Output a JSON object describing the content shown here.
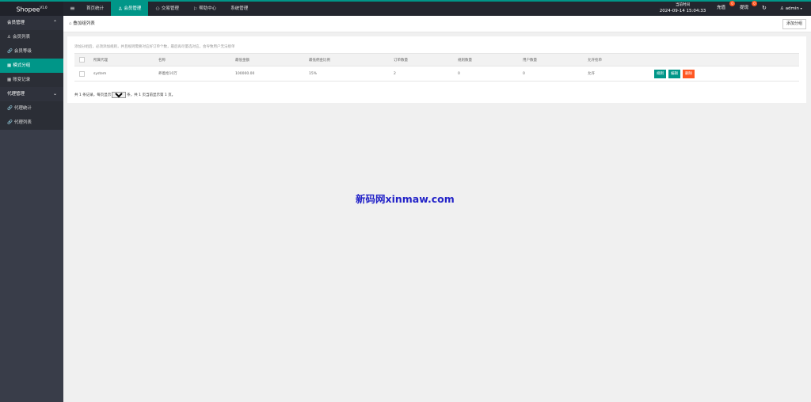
{
  "app": {
    "name": "Shopee",
    "version": "V1.0"
  },
  "topnav": {
    "toggle_icon": "≡",
    "items": [
      {
        "label": "首页统计",
        "icon": ""
      },
      {
        "label": "会员管理",
        "icon": "♙"
      },
      {
        "label": "交易管理",
        "icon": "⚇"
      },
      {
        "label": "帮助中心",
        "icon": "⚐"
      },
      {
        "label": "系统管理",
        "icon": ""
      }
    ],
    "active_index": 1,
    "clock_label": "当前时间",
    "clock_value": "2024-09-14 15:04:33",
    "recharge_label": "充值",
    "recharge_badge": "0",
    "withdraw_label": "提现",
    "withdraw_badge": "0",
    "refresh_icon": "↻",
    "user_label": "admin"
  },
  "sidebar": {
    "groups": [
      {
        "label": "会员管理",
        "items": [
          {
            "label": "会员列表",
            "icon": "user-icon"
          },
          {
            "label": "会员等级",
            "icon": "link-icon"
          },
          {
            "label": "模式分组",
            "icon": "table-icon"
          },
          {
            "label": "账变记录",
            "icon": "table-icon"
          }
        ]
      },
      {
        "label": "代理管理",
        "items": [
          {
            "label": "代理统计",
            "icon": "link-icon"
          },
          {
            "label": "代理列表",
            "icon": "link-icon"
          }
        ]
      }
    ],
    "active": "模式分组"
  },
  "page": {
    "breadcrumb": "叠加组列表",
    "add_button": "添加分组",
    "note": "添加分组后，必须添加规则，并且规则需要对应好订单个数，最后再尽量选对应，会导致用户无法接单"
  },
  "table": {
    "headers": [
      "所属代理",
      "名称",
      "最低金额",
      "最低佣金比例",
      "订单数量",
      "规则数量",
      "用户数量",
      "允许抢单"
    ],
    "rows": [
      {
        "agent": "system",
        "name": "养着抢10万",
        "min_amount": "100000.00",
        "min_commission": "15%",
        "orders": "2",
        "rules": "0",
        "users": "0",
        "allow": "允许"
      }
    ],
    "actions": [
      "规则",
      "编辑",
      "删除"
    ]
  },
  "pager": {
    "prefix": "共 1 条记录，每页显示",
    "page_size": "20",
    "suffix": "条，共 1 页当前显示第 1 页。"
  },
  "watermark": "新码网xinmaw.com",
  "colors": {
    "accent": "#009688",
    "danger": "#ff5722",
    "topbar": "#23262e",
    "sidebar": "#393d49"
  }
}
